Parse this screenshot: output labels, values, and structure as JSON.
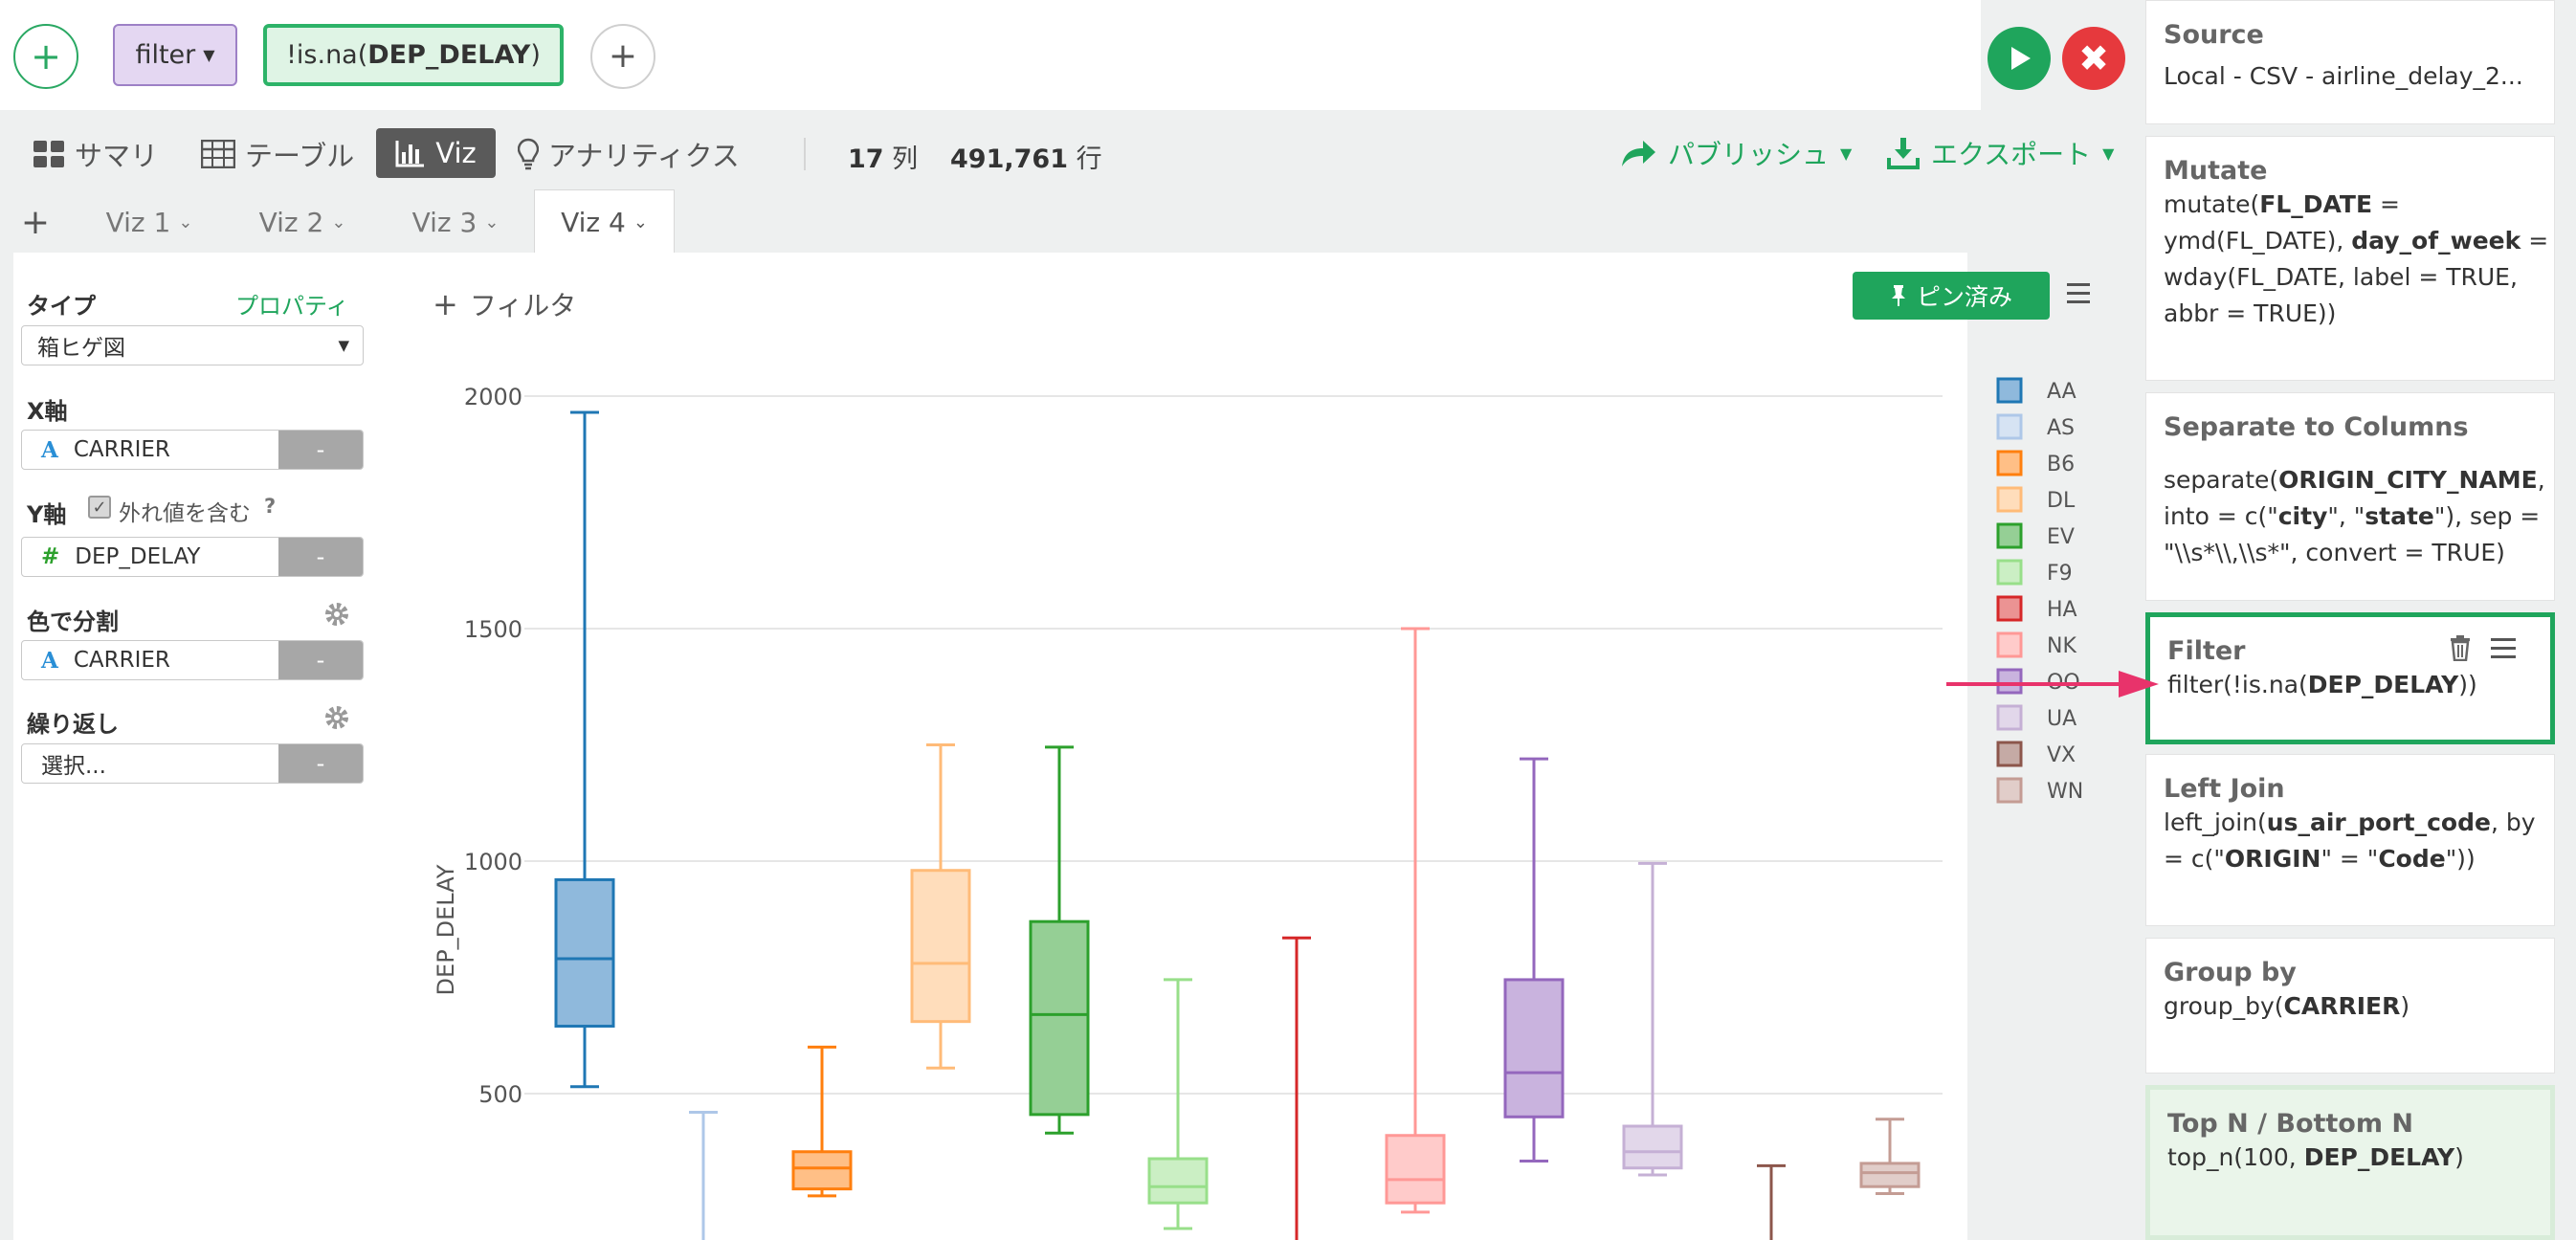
{
  "toolbar": {
    "command": "filter",
    "expression_prefix": "!is.na(",
    "expression_arg": "DEP_DELAY",
    "expression_suffix": ")"
  },
  "views": {
    "summary": "サマリ",
    "table": "テーブル",
    "viz": "Viz",
    "analytics": "アナリティクス",
    "columns_value": "17",
    "columns_unit": "列",
    "rows_value": "491,761",
    "rows_unit": "行",
    "publish": "パブリッシュ",
    "export": "エクスポート"
  },
  "tabs": [
    "Viz 1",
    "Viz 2",
    "Viz 3",
    "Viz 4"
  ],
  "settings": {
    "type_label": "タイプ",
    "property_link": "プロパティ",
    "type_value": "箱ヒゲ図",
    "x_label": "X軸",
    "x_value": "CARRIER",
    "y_label": "Y軸",
    "outlier_label": "外れ値を含む",
    "help": "?",
    "y_value": "DEP_DELAY",
    "color_label": "色で分割",
    "color_value": "CARRIER",
    "repeat_label": "繰り返し",
    "repeat_value": "選択...",
    "minus": "-"
  },
  "chart_header": {
    "filter": "フィルタ",
    "pinned": "ピン済み"
  },
  "chart_data": {
    "type": "box",
    "ylabel": "DEP_DELAY",
    "yticks": [
      500,
      1000,
      1500,
      2000
    ],
    "ylim_visible": [
      100,
      2000
    ],
    "series": [
      {
        "name": "AA",
        "color": "#1f77b4",
        "fill": "#8fb9dc",
        "whisker_high": 1965,
        "q3": 960,
        "median": 790,
        "q1": 645,
        "whisker_low": 515
      },
      {
        "name": "AS",
        "color": "#aec7e8",
        "fill": "#d6e3f3",
        "whisker_high": 460,
        "q3": null,
        "median": null,
        "q1": null,
        "whisker_low": null
      },
      {
        "name": "B6",
        "color": "#ff7f0e",
        "fill": "#ffbf86",
        "whisker_high": 600,
        "q3": 375,
        "median": 340,
        "q1": 295,
        "whisker_low": 280
      },
      {
        "name": "DL",
        "color": "#ffbb78",
        "fill": "#ffddbb",
        "whisker_high": 1250,
        "q3": 980,
        "median": 780,
        "q1": 655,
        "whisker_low": 555
      },
      {
        "name": "EV",
        "color": "#2ca02c",
        "fill": "#95cf95",
        "whisker_high": 1245,
        "q3": 870,
        "median": 670,
        "q1": 455,
        "whisker_low": 415
      },
      {
        "name": "F9",
        "color": "#98df8a",
        "fill": "#cbefc4",
        "whisker_high": 745,
        "q3": 360,
        "median": 300,
        "q1": 265,
        "whisker_low": 210
      },
      {
        "name": "HA",
        "color": "#d62728",
        "fill": "#eb9393",
        "whisker_high": 835,
        "q3": null,
        "median": null,
        "q1": null,
        "whisker_low": null
      },
      {
        "name": "NK",
        "color": "#ff9896",
        "fill": "#ffcbca",
        "whisker_high": 1500,
        "q3": 410,
        "median": 315,
        "q1": 265,
        "whisker_low": 245
      },
      {
        "name": "OO",
        "color": "#9467bd",
        "fill": "#c9b3de",
        "whisker_high": 1220,
        "q3": 745,
        "median": 545,
        "q1": 450,
        "whisker_low": 355
      },
      {
        "name": "UA",
        "color": "#c5b0d5",
        "fill": "#e2d7ea",
        "whisker_high": 995,
        "q3": 430,
        "median": 375,
        "q1": 340,
        "whisker_low": 325
      },
      {
        "name": "VX",
        "color": "#8c564b",
        "fill": "#c5aaa5",
        "whisker_high": 345,
        "q3": null,
        "median": null,
        "q1": null,
        "whisker_low": null
      },
      {
        "name": "WN",
        "color": "#c49c94",
        "fill": "#e1cdc9",
        "whisker_high": 445,
        "q3": 350,
        "median": 330,
        "q1": 300,
        "whisker_low": 285
      }
    ]
  },
  "steps": [
    {
      "title": "Source",
      "body": "Local - CSV - airline_delay_2..."
    },
    {
      "title": "Mutate",
      "body_html": "mutate(<b>FL_DATE</b> =<br>ymd(FL_DATE), <b>day_of_week</b> =<br>wday(FL_DATE, label = TRUE,<br>abbr = TRUE))"
    },
    {
      "title": "Separate to Columns",
      "body_html": "separate(<b>ORIGIN_CITY_NAME</b>,<br>into = c(\"<b>city</b>\", \"<b>state</b>\"), sep =<br>\"\\\\s*\\\\,\\\\s*\", convert = TRUE)"
    },
    {
      "title": "Filter",
      "body_html": "filter(!is.na(<b>DEP_DELAY</b>))"
    },
    {
      "title": "Left Join",
      "body_html": "left_join(<b>us_air_port_code</b>, by<br>= c(\"<b>ORIGIN</b>\" = \"<b>Code</b>\"))"
    },
    {
      "title": "Group by",
      "body_html": "group_by(<b>CARRIER</b>)"
    },
    {
      "title": "Top N / Bottom N",
      "body_html": "top_n(100, <b>DEP_DELAY</b>)"
    }
  ],
  "colors": {
    "accent": "#1fa55c",
    "stop": "#e6393d",
    "arrow": "#e8336b"
  }
}
